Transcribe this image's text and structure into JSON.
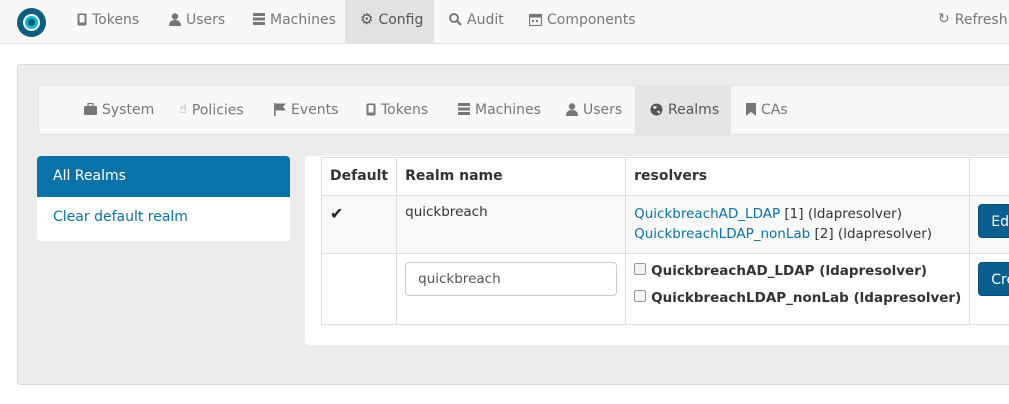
{
  "topnav": {
    "items": [
      {
        "label": "Tokens",
        "icon": "tablet-icon"
      },
      {
        "label": "Users",
        "icon": "user-icon"
      },
      {
        "label": "Machines",
        "icon": "server-icon"
      },
      {
        "label": "Config",
        "icon": "gear-icon",
        "active": true
      },
      {
        "label": "Audit",
        "icon": "search-icon"
      },
      {
        "label": "Components",
        "icon": "calendar-icon"
      }
    ],
    "refresh_label": "Refresh"
  },
  "subnav": {
    "items": [
      {
        "label": "System",
        "icon": "briefcase-icon"
      },
      {
        "label": "Policies",
        "icon": "hand-pointer-icon"
      },
      {
        "label": "Events",
        "icon": "flag-icon"
      },
      {
        "label": "Tokens",
        "icon": "tablet-icon"
      },
      {
        "label": "Machines",
        "icon": "server-icon"
      },
      {
        "label": "Users",
        "icon": "user-icon"
      },
      {
        "label": "Realms",
        "icon": "globe-icon",
        "active": true
      },
      {
        "label": "CAs",
        "icon": "bookmark-icon"
      }
    ]
  },
  "sidebar": {
    "all_realms": "All Realms",
    "clear_default": "Clear default realm"
  },
  "table": {
    "headers": [
      "Default",
      "Realm name",
      "resolvers",
      ""
    ],
    "row1": {
      "default_mark": "✔",
      "realm_name": "quickbreach",
      "resolvers": [
        {
          "name": "QuickbreachAD_LDAP",
          "suffix": " [1] (ldapresolver)"
        },
        {
          "name": "QuickbreachLDAP_nonLab",
          "suffix": " [2] (ldapresolver)"
        }
      ],
      "button": "Edit"
    },
    "row2": {
      "input_value": "quickbreach",
      "options": [
        "QuickbreachAD_LDAP (ldapresolver)",
        "QuickbreachLDAP_nonLab (ldapresolver)"
      ],
      "button": "Create"
    }
  },
  "colors": {
    "accent": "#0b72a8",
    "button": "#0b5f8f"
  }
}
